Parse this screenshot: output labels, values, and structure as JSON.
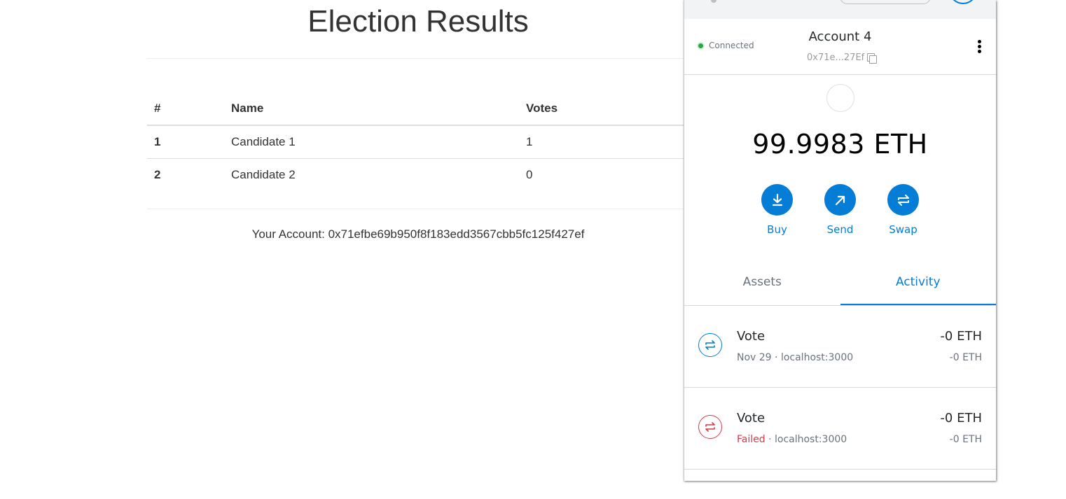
{
  "page": {
    "title": "Election Results",
    "table": {
      "headers": [
        "#",
        "Name",
        "Votes"
      ],
      "rows": [
        {
          "id": "1",
          "name": "Candidate 1",
          "votes": "1"
        },
        {
          "id": "2",
          "name": "Candidate 2",
          "votes": "0"
        }
      ]
    },
    "account_line": "Your Account: 0x71efbe69b950f8f183edd3567cbb5fc125f427ef"
  },
  "wallet": {
    "status": "Connected",
    "account_name": "Account 4",
    "account_address_short": "0x71e...27Ef",
    "balance": "99.9983 ETH",
    "actions": {
      "buy": "Buy",
      "send": "Send",
      "swap": "Swap"
    },
    "tabs": {
      "assets": "Assets",
      "activity": "Activity"
    },
    "activity": [
      {
        "title": "Vote",
        "date": "Nov 29",
        "sep": " · ",
        "origin": "localhost:3000",
        "amount": "-0 ETH",
        "amount_secondary": "-0 ETH"
      },
      {
        "title": "Vote",
        "status": "Failed",
        "sep": " · ",
        "origin": "localhost:3000",
        "amount": "-0 ETH",
        "amount_secondary": "-0 ETH"
      }
    ],
    "colors": {
      "accent": "#037dd6",
      "failed": "#d73a49",
      "connected": "#28a745"
    }
  }
}
